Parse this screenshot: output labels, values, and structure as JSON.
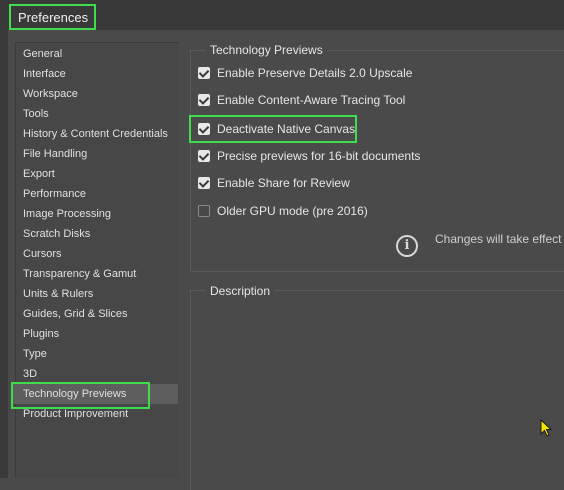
{
  "window": {
    "title": "Preferences"
  },
  "sidebar": {
    "items": [
      {
        "label": "General"
      },
      {
        "label": "Interface"
      },
      {
        "label": "Workspace"
      },
      {
        "label": "Tools"
      },
      {
        "label": "History & Content Credentials"
      },
      {
        "label": "File Handling"
      },
      {
        "label": "Export"
      },
      {
        "label": "Performance"
      },
      {
        "label": "Image Processing"
      },
      {
        "label": "Scratch Disks"
      },
      {
        "label": "Cursors"
      },
      {
        "label": "Transparency & Gamut"
      },
      {
        "label": "Units & Rulers"
      },
      {
        "label": "Guides, Grid & Slices"
      },
      {
        "label": "Plugins"
      },
      {
        "label": "Type"
      },
      {
        "label": "3D"
      },
      {
        "label": "Technology Previews",
        "selected": true
      },
      {
        "label": "Product Improvement"
      }
    ]
  },
  "panel": {
    "section_title": "Technology Previews",
    "options": [
      {
        "label": "Enable Preserve Details 2.0 Upscale",
        "checked": true
      },
      {
        "label": "Enable Content-Aware Tracing Tool",
        "checked": true
      },
      {
        "label": "Deactivate Native Canvas",
        "checked": true
      },
      {
        "label": "Precise previews for 16-bit documents",
        "checked": true
      },
      {
        "label": "Enable Share for Review",
        "checked": true
      },
      {
        "label": "Older GPU mode (pre 2016)",
        "checked": false
      }
    ],
    "info_icon": "info-circle-icon",
    "info_text": "Changes will take effect",
    "description_title": "Description"
  },
  "colors": {
    "highlight": "#3fdc4b",
    "background": "#4a4a4a"
  }
}
